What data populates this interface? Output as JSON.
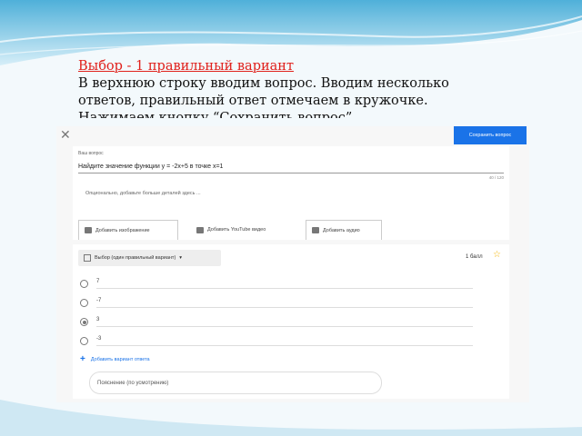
{
  "caption": {
    "title": "Выбор - 1 правильный вариант",
    "body": "В верхнюю строку вводим вопрос. Вводим несколько ответов, правильный ответ отмечаем в кружочке. Нажимаем кнопку “Сохранить вопрос”"
  },
  "editor": {
    "close_icon": "close-icon",
    "save_label": "Сохранить вопрос",
    "question_label": "Ваш вопрос",
    "question_text": "Найдите значение функции  у = -2х+5 в точке х=1",
    "char_count": "40 / 120",
    "hint": "Опционально, добавьте больше деталей здесь ...",
    "media_buttons": [
      "Добавить изображение",
      "Добавить YouTube видео",
      "Добавить аудио"
    ],
    "type_select": "Выбор (один правильный вариант)",
    "points": "1 балл",
    "options": [
      "7",
      "-7",
      "3",
      "-3"
    ],
    "selected_option_index": 2,
    "add_option": "Добавить вариант ответа",
    "explanation_placeholder": "Пояснение (по усмотрению)",
    "colors": {
      "accent": "#1a73e8",
      "caption_title": "#e0201b",
      "star": "#f4b400"
    }
  }
}
